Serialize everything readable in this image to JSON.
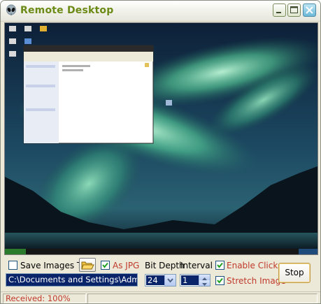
{
  "window": {
    "title": "Remote Desktop",
    "accent_color": "#6b8a16",
    "icon": "alien-head-icon"
  },
  "titlebar_buttons": {
    "minimize": "minimize-icon",
    "maximize": "maximize-icon",
    "close": "close-icon"
  },
  "controls": {
    "save_images": {
      "label": "Save Images To",
      "checked": false
    },
    "folder_button": {
      "icon": "open-folder-icon"
    },
    "as_jpg": {
      "label": "As JPG",
      "checked": true
    },
    "save_path": {
      "value": "C:\\Documents and Settings\\Administr"
    },
    "bit_depth": {
      "label": "Bit Depth",
      "value": "24"
    },
    "interval": {
      "label": "Interval",
      "value": "1"
    },
    "enable_clicks": {
      "label": "Enable Clicks",
      "checked": true
    },
    "stretch_image": {
      "label": "Stretch Image",
      "checked": true
    },
    "stop_button": {
      "label": "Stop"
    }
  },
  "status": {
    "received": "Received: 100%"
  }
}
